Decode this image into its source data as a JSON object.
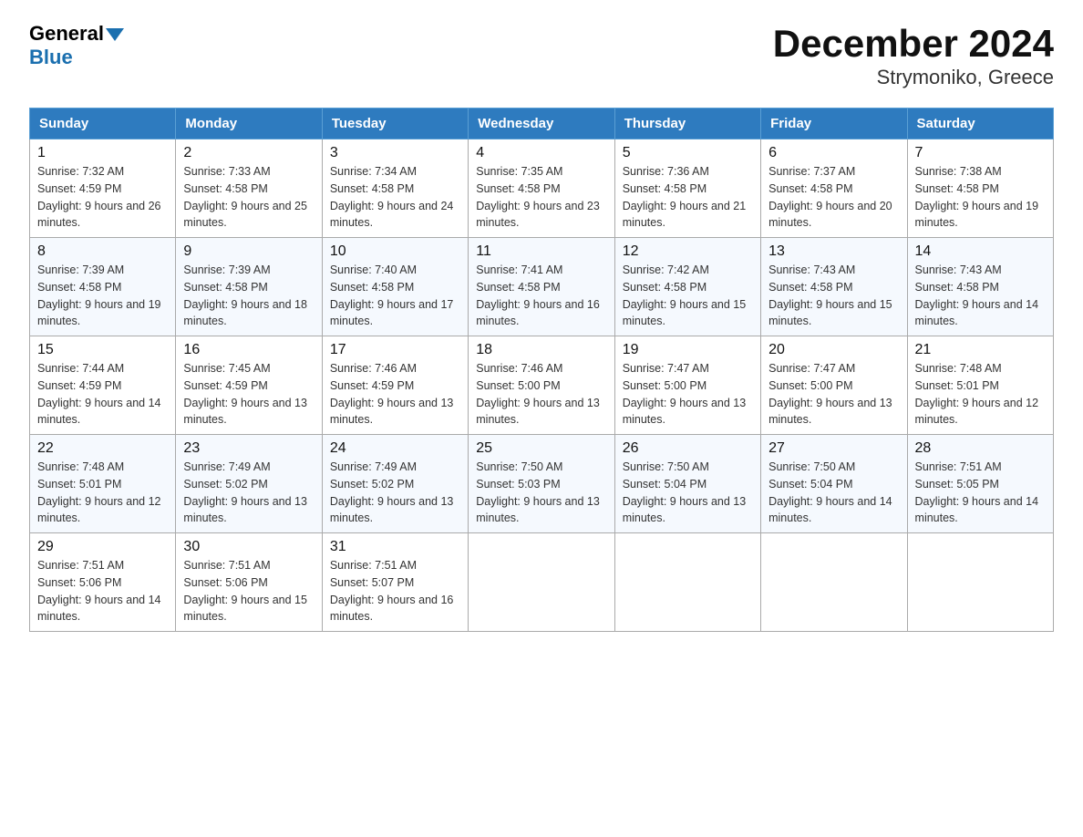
{
  "header": {
    "logo_general": "General",
    "logo_blue": "Blue",
    "title": "December 2024",
    "subtitle": "Strymoniko, Greece"
  },
  "days_of_week": [
    "Sunday",
    "Monday",
    "Tuesday",
    "Wednesday",
    "Thursday",
    "Friday",
    "Saturday"
  ],
  "weeks": [
    [
      {
        "num": "1",
        "sunrise": "7:32 AM",
        "sunset": "4:59 PM",
        "daylight": "9 hours and 26 minutes."
      },
      {
        "num": "2",
        "sunrise": "7:33 AM",
        "sunset": "4:58 PM",
        "daylight": "9 hours and 25 minutes."
      },
      {
        "num": "3",
        "sunrise": "7:34 AM",
        "sunset": "4:58 PM",
        "daylight": "9 hours and 24 minutes."
      },
      {
        "num": "4",
        "sunrise": "7:35 AM",
        "sunset": "4:58 PM",
        "daylight": "9 hours and 23 minutes."
      },
      {
        "num": "5",
        "sunrise": "7:36 AM",
        "sunset": "4:58 PM",
        "daylight": "9 hours and 21 minutes."
      },
      {
        "num": "6",
        "sunrise": "7:37 AM",
        "sunset": "4:58 PM",
        "daylight": "9 hours and 20 minutes."
      },
      {
        "num": "7",
        "sunrise": "7:38 AM",
        "sunset": "4:58 PM",
        "daylight": "9 hours and 19 minutes."
      }
    ],
    [
      {
        "num": "8",
        "sunrise": "7:39 AM",
        "sunset": "4:58 PM",
        "daylight": "9 hours and 19 minutes."
      },
      {
        "num": "9",
        "sunrise": "7:39 AM",
        "sunset": "4:58 PM",
        "daylight": "9 hours and 18 minutes."
      },
      {
        "num": "10",
        "sunrise": "7:40 AM",
        "sunset": "4:58 PM",
        "daylight": "9 hours and 17 minutes."
      },
      {
        "num": "11",
        "sunrise": "7:41 AM",
        "sunset": "4:58 PM",
        "daylight": "9 hours and 16 minutes."
      },
      {
        "num": "12",
        "sunrise": "7:42 AM",
        "sunset": "4:58 PM",
        "daylight": "9 hours and 15 minutes."
      },
      {
        "num": "13",
        "sunrise": "7:43 AM",
        "sunset": "4:58 PM",
        "daylight": "9 hours and 15 minutes."
      },
      {
        "num": "14",
        "sunrise": "7:43 AM",
        "sunset": "4:58 PM",
        "daylight": "9 hours and 14 minutes."
      }
    ],
    [
      {
        "num": "15",
        "sunrise": "7:44 AM",
        "sunset": "4:59 PM",
        "daylight": "9 hours and 14 minutes."
      },
      {
        "num": "16",
        "sunrise": "7:45 AM",
        "sunset": "4:59 PM",
        "daylight": "9 hours and 13 minutes."
      },
      {
        "num": "17",
        "sunrise": "7:46 AM",
        "sunset": "4:59 PM",
        "daylight": "9 hours and 13 minutes."
      },
      {
        "num": "18",
        "sunrise": "7:46 AM",
        "sunset": "5:00 PM",
        "daylight": "9 hours and 13 minutes."
      },
      {
        "num": "19",
        "sunrise": "7:47 AM",
        "sunset": "5:00 PM",
        "daylight": "9 hours and 13 minutes."
      },
      {
        "num": "20",
        "sunrise": "7:47 AM",
        "sunset": "5:00 PM",
        "daylight": "9 hours and 13 minutes."
      },
      {
        "num": "21",
        "sunrise": "7:48 AM",
        "sunset": "5:01 PM",
        "daylight": "9 hours and 12 minutes."
      }
    ],
    [
      {
        "num": "22",
        "sunrise": "7:48 AM",
        "sunset": "5:01 PM",
        "daylight": "9 hours and 12 minutes."
      },
      {
        "num": "23",
        "sunrise": "7:49 AM",
        "sunset": "5:02 PM",
        "daylight": "9 hours and 13 minutes."
      },
      {
        "num": "24",
        "sunrise": "7:49 AM",
        "sunset": "5:02 PM",
        "daylight": "9 hours and 13 minutes."
      },
      {
        "num": "25",
        "sunrise": "7:50 AM",
        "sunset": "5:03 PM",
        "daylight": "9 hours and 13 minutes."
      },
      {
        "num": "26",
        "sunrise": "7:50 AM",
        "sunset": "5:04 PM",
        "daylight": "9 hours and 13 minutes."
      },
      {
        "num": "27",
        "sunrise": "7:50 AM",
        "sunset": "5:04 PM",
        "daylight": "9 hours and 14 minutes."
      },
      {
        "num": "28",
        "sunrise": "7:51 AM",
        "sunset": "5:05 PM",
        "daylight": "9 hours and 14 minutes."
      }
    ],
    [
      {
        "num": "29",
        "sunrise": "7:51 AM",
        "sunset": "5:06 PM",
        "daylight": "9 hours and 14 minutes."
      },
      {
        "num": "30",
        "sunrise": "7:51 AM",
        "sunset": "5:06 PM",
        "daylight": "9 hours and 15 minutes."
      },
      {
        "num": "31",
        "sunrise": "7:51 AM",
        "sunset": "5:07 PM",
        "daylight": "9 hours and 16 minutes."
      },
      null,
      null,
      null,
      null
    ]
  ]
}
